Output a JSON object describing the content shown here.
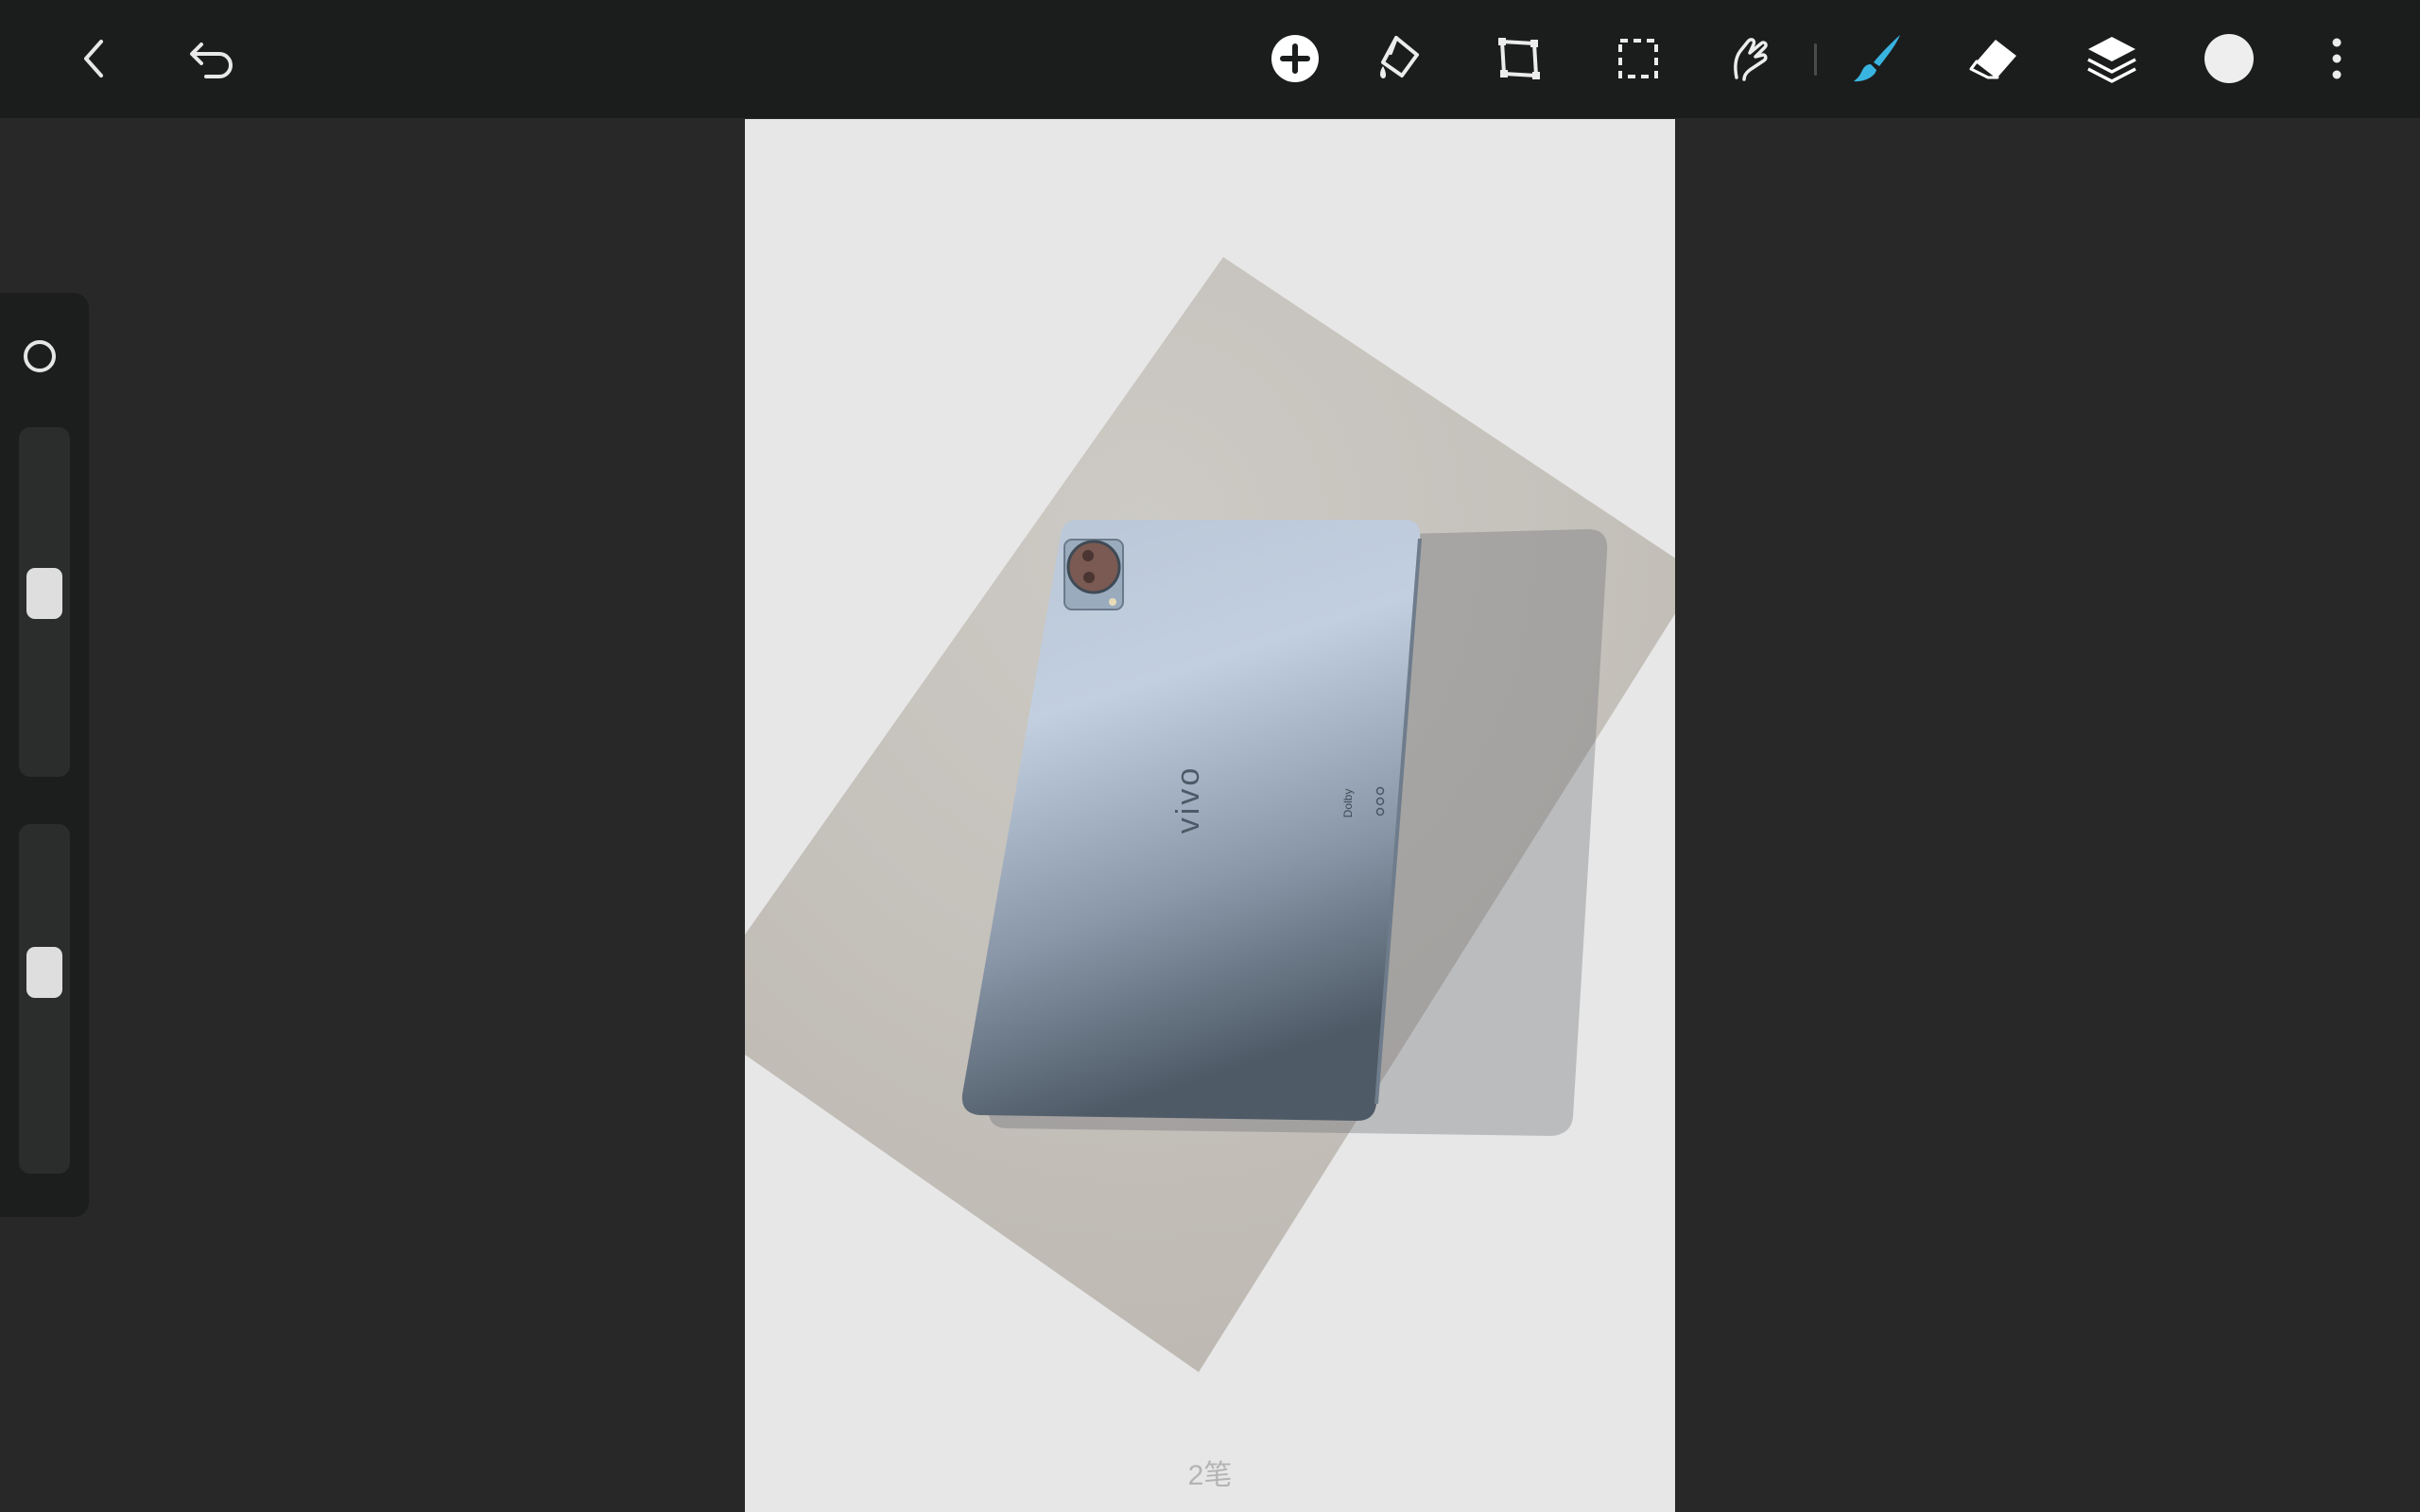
{
  "toolbar": {
    "left": [
      {
        "name": "back-button",
        "icon": "chevron-left-icon"
      },
      {
        "name": "undo-button",
        "icon": "undo-arrow-icon"
      }
    ],
    "tools": [
      {
        "name": "add-button",
        "icon": "plus-circle-icon"
      },
      {
        "name": "fill-tool-button",
        "icon": "paint-bucket-icon"
      },
      {
        "name": "transform-tool-button",
        "icon": "transform-frame-icon"
      },
      {
        "name": "selection-tool-button",
        "icon": "dashed-selection-icon"
      },
      {
        "name": "smudge-tool-button",
        "icon": "finger-smudge-icon"
      },
      {
        "name": "brush-tool-button",
        "icon": "brush-icon",
        "active": true
      },
      {
        "name": "eraser-tool-button",
        "icon": "eraser-icon"
      },
      {
        "name": "layers-button",
        "icon": "layers-icon"
      },
      {
        "name": "color-button",
        "icon": "color-swatch"
      },
      {
        "name": "more-button",
        "icon": "more-vertical-icon"
      }
    ],
    "active_color": "#39b4e0",
    "current_color": "#eeeeee"
  },
  "side_panel": {
    "shape_icon": "circle-outline-icon",
    "brush_size_level": 0.47,
    "brush_opacity_level": 0.41
  },
  "canvas": {
    "background": "#e7e7e7",
    "paper_color": "#c5c1bb",
    "tablet_color": "#8c9bae",
    "tablet_brand": "vivo",
    "dolby_label": "Dolby",
    "stroke_count": "2笔"
  }
}
